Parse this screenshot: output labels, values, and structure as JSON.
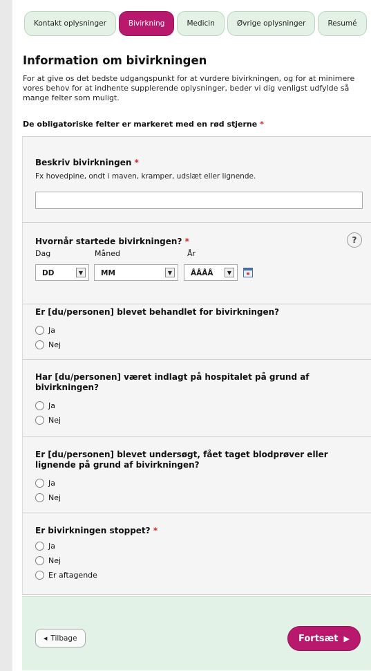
{
  "tabs": [
    {
      "label": "Kontakt oplysninger",
      "active": false
    },
    {
      "label": "Bivirkning",
      "active": true
    },
    {
      "label": "Medicin",
      "active": false
    },
    {
      "label": "Øvrige oplysninger",
      "active": false
    },
    {
      "label": "Resumé",
      "active": false
    }
  ],
  "heading": "Information om bivirkningen",
  "intro": "For at give os det bedste udgangspunkt for at vurdere bivirkningen, og for at minimere vores behov for at indhente supplerende oplysninger, beder vi dig venligst udfylde så mange felter som muligt.",
  "required_note": "De obligatoriske felter er markeret med en rød stjerne",
  "required_star": "*",
  "describe": {
    "question": "Beskriv bivirkningen",
    "hint": "Fx hovedpine, ondt i maven, kramper, udslæt eller lignende.",
    "value": ""
  },
  "start_date": {
    "question": "Hvornår startede bivirkningen?",
    "help": "?",
    "day_label": "Dag",
    "month_label": "Måned",
    "year_label": "År",
    "day_value": "DD",
    "month_value": "MM",
    "year_value": "ÅÅÅÅ",
    "dropdown_arrow": "▼"
  },
  "treated": {
    "question": "Er [du/personen] blevet behandlet for bivirkningen?",
    "options": [
      "Ja",
      "Nej"
    ]
  },
  "hospitalized": {
    "question": "Har [du/personen] været indlagt på hospitalet på grund af bivirkningen?",
    "options": [
      "Ja",
      "Nej"
    ]
  },
  "examined": {
    "question": "Er [du/personen] blevet undersøgt, fået taget blodprøver eller lignende på grund af bivirkningen?",
    "options": [
      "Ja",
      "Nej"
    ]
  },
  "stopped": {
    "question": "Er bivirkningen stoppet?",
    "options": [
      "Ja",
      "Nej",
      "Er aftagende"
    ]
  },
  "footer": {
    "back_label": "Tilbage",
    "back_arrow": "◀",
    "next_label": "Fortsæt",
    "next_arrow": "▶"
  },
  "colors": {
    "accent": "#b8196c",
    "tab_inactive": "#e4f2e6",
    "footer_bg": "#e3f2e6",
    "required": "#d22424"
  }
}
